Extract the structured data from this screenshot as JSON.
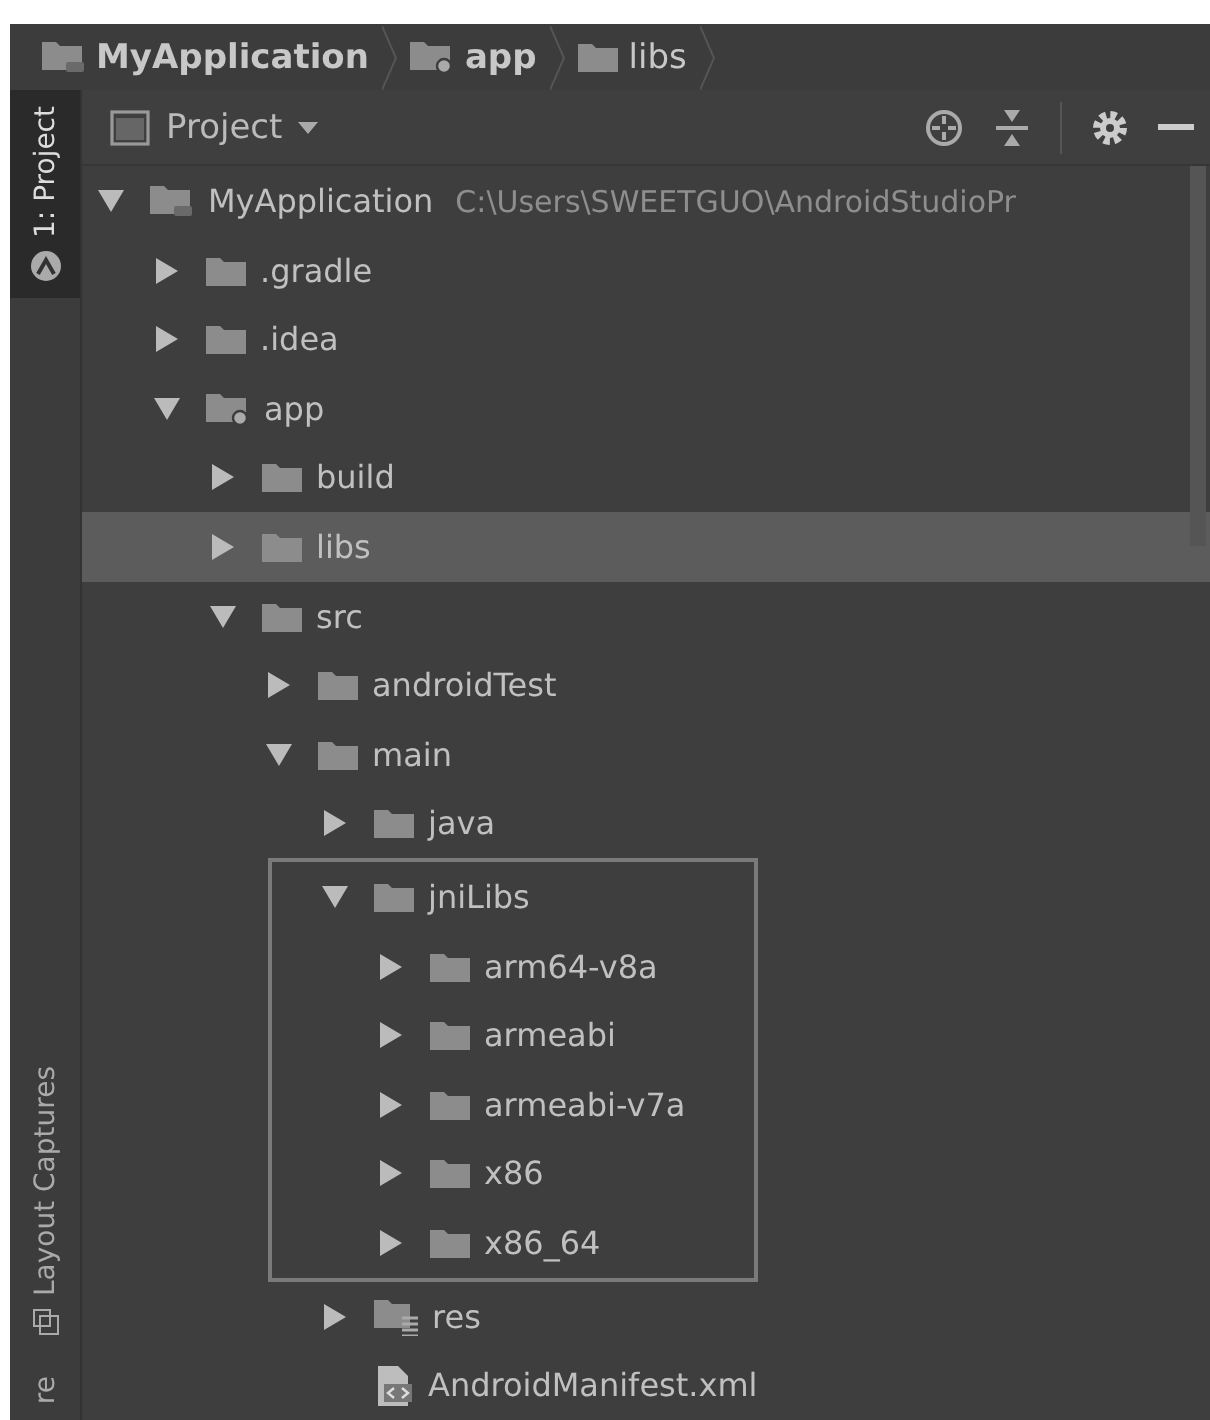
{
  "breadcrumbs": [
    {
      "label": "MyApplication",
      "kind": "project",
      "bold": true
    },
    {
      "label": "app",
      "kind": "module",
      "bold": true
    },
    {
      "label": "libs",
      "kind": "folder",
      "bold": false
    }
  ],
  "side_tabs": [
    {
      "label": "1: Project",
      "kind": "project",
      "selected": true
    },
    {
      "label": "Layout Captures",
      "kind": "captures",
      "selected": false
    },
    {
      "label": "re",
      "kind": "plain",
      "selected": false
    }
  ],
  "panel": {
    "title": "Project"
  },
  "tree": [
    {
      "label": "MyApplication",
      "path": "C:\\Users\\SWEETGUO\\AndroidStudioPr",
      "kind": "project",
      "expanded": true,
      "selected": false,
      "children": [
        {
          "label": ".gradle",
          "kind": "folder",
          "expanded": false,
          "selected": false
        },
        {
          "label": ".idea",
          "kind": "folder",
          "expanded": false,
          "selected": false
        },
        {
          "label": "app",
          "kind": "module",
          "expanded": true,
          "selected": false,
          "children": [
            {
              "label": "build",
              "kind": "folder",
              "expanded": false,
              "selected": false
            },
            {
              "label": "libs",
              "kind": "folder",
              "expanded": false,
              "selected": true
            },
            {
              "label": "src",
              "kind": "folder",
              "expanded": true,
              "selected": false,
              "children": [
                {
                  "label": "androidTest",
                  "kind": "folder",
                  "expanded": false,
                  "selected": false
                },
                {
                  "label": "main",
                  "kind": "folder",
                  "expanded": true,
                  "selected": false,
                  "children": [
                    {
                      "label": "java",
                      "kind": "folder",
                      "expanded": false,
                      "selected": false
                    },
                    {
                      "label": "jniLibs",
                      "kind": "folder",
                      "expanded": true,
                      "selected": false,
                      "highlighted": true,
                      "children": [
                        {
                          "label": "arm64-v8a",
                          "kind": "folder",
                          "expanded": false,
                          "selected": false
                        },
                        {
                          "label": "armeabi",
                          "kind": "folder",
                          "expanded": false,
                          "selected": false
                        },
                        {
                          "label": "armeabi-v7a",
                          "kind": "folder",
                          "expanded": false,
                          "selected": false
                        },
                        {
                          "label": "x86",
                          "kind": "folder",
                          "expanded": false,
                          "selected": false
                        },
                        {
                          "label": "x86_64",
                          "kind": "folder",
                          "expanded": false,
                          "selected": false
                        }
                      ]
                    },
                    {
                      "label": "res",
                      "kind": "resources",
                      "expanded": false,
                      "selected": false
                    },
                    {
                      "label": "AndroidManifest.xml",
                      "kind": "manifest",
                      "selected": false
                    }
                  ]
                }
              ]
            }
          ]
        }
      ]
    }
  ]
}
